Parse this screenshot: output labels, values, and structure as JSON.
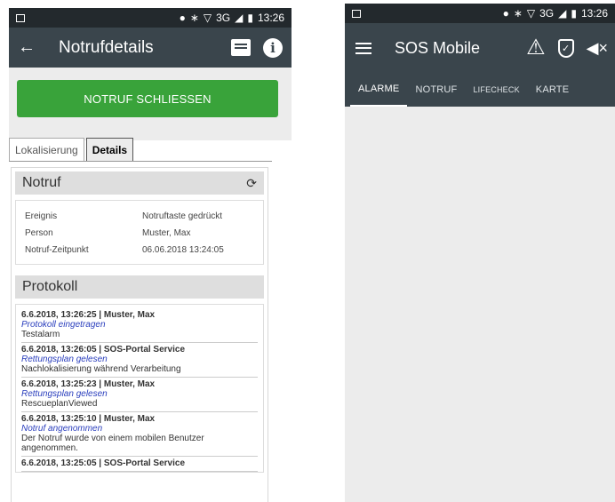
{
  "left": {
    "status": {
      "time": "13:26",
      "network": "3G"
    },
    "toolbar": {
      "title": "Notrufdetails"
    },
    "close_button": "NOTRUF SCHLIESSEN",
    "tabs": [
      {
        "label": "Lokalisierung"
      },
      {
        "label": "Details"
      }
    ],
    "notruf": {
      "heading": "Notruf",
      "rows": [
        {
          "key": "Ereignis",
          "value": "Notruftaste gedrückt"
        },
        {
          "key": "Person",
          "value": "Muster, Max"
        },
        {
          "key": "Notruf-Zeitpunkt",
          "value": "06.06.2018 13:24:05"
        }
      ]
    },
    "protokoll": {
      "heading": "Protokoll",
      "entries": [
        {
          "header": "6.6.2018, 13:26:25 | Muster, Max",
          "action": "Protokoll eingetragen",
          "text": "Testalarm"
        },
        {
          "header": "6.6.2018, 13:26:05 | SOS-Portal Service",
          "action": "Rettungsplan gelesen",
          "text": "Nachlokalisierung während Verarbeitung"
        },
        {
          "header": "6.6.2018, 13:25:23 | Muster, Max",
          "action": "Rettungsplan gelesen",
          "text": "RescueplanViewed"
        },
        {
          "header": "6.6.2018, 13:25:10 | Muster, Max",
          "action": "Notruf angenommen",
          "text": "Der Notruf wurde von einem mobilen Benutzer angenommen."
        },
        {
          "header": "6.6.2018, 13:25:05 | SOS-Portal Service",
          "action": "",
          "text": ""
        }
      ]
    }
  },
  "right": {
    "status": {
      "time": "13:26",
      "network": "3G"
    },
    "toolbar": {
      "title": "SOS Mobile"
    },
    "tabs": [
      {
        "label": "ALARME"
      },
      {
        "label": "NOTRUF"
      },
      {
        "label": "LIFECHECK"
      },
      {
        "label": "KARTE"
      }
    ]
  }
}
